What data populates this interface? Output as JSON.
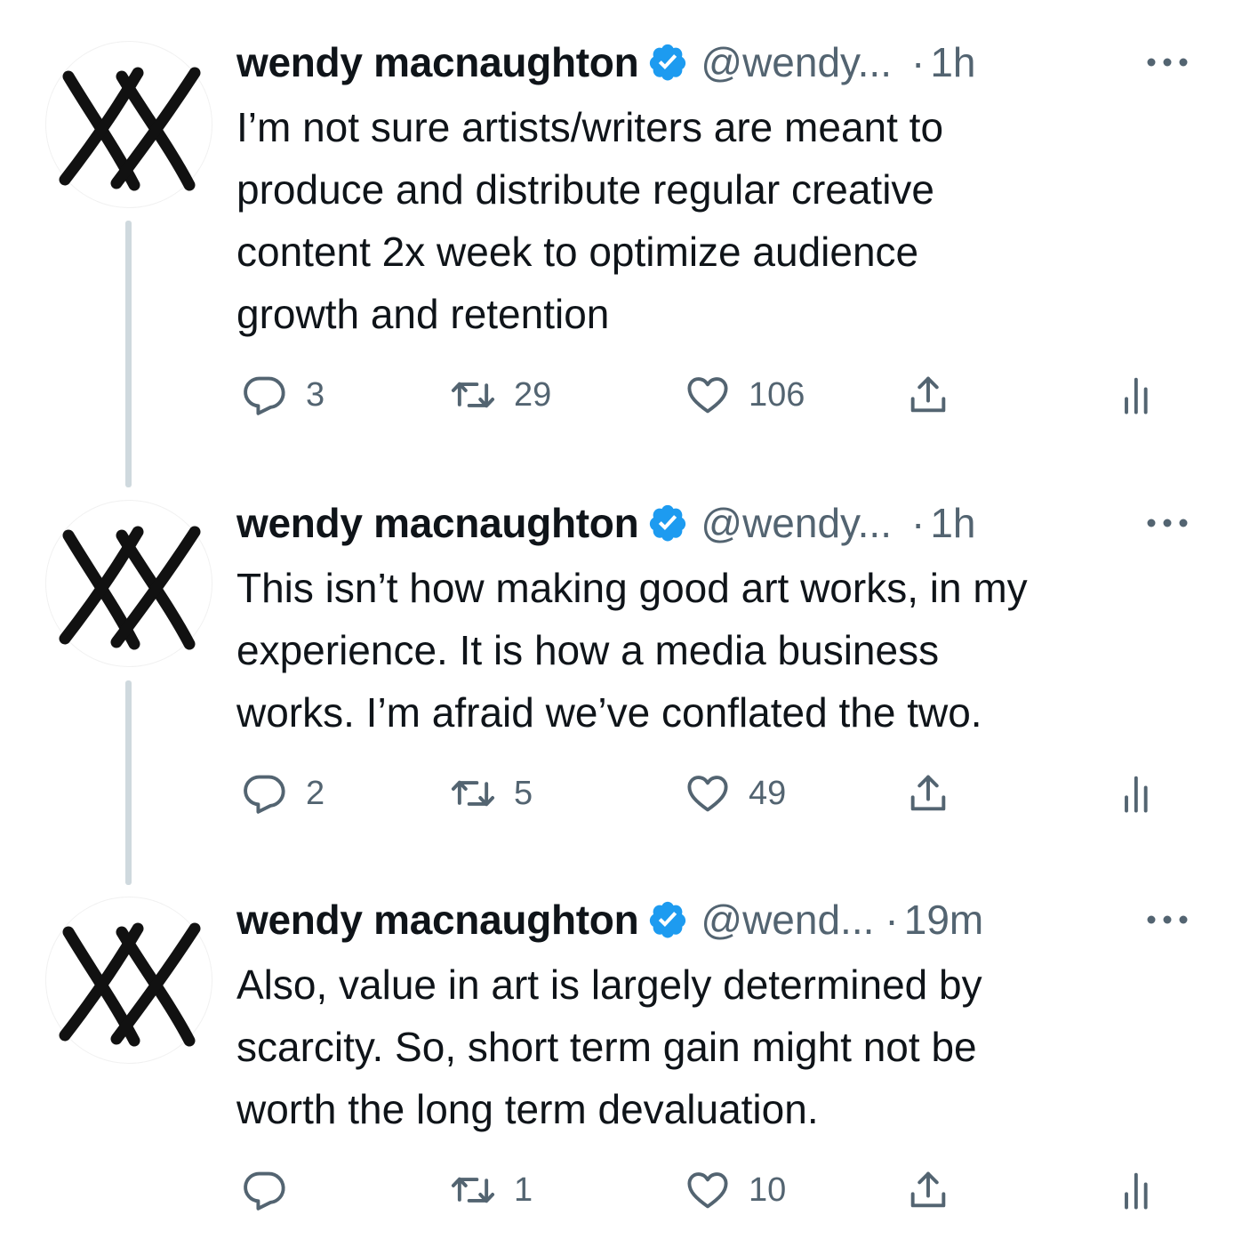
{
  "colors": {
    "text": "#0f1419",
    "muted": "#536471",
    "verified": "#1d9bf0",
    "thread_line": "#cfd9de"
  },
  "tweets": [
    {
      "name": "wendy macnaughton",
      "handle": "@wendy...",
      "separator": "·",
      "time": "1h",
      "text": "I’m not sure artists/writers are meant to\nproduce and distribute regular creative\ncontent 2x week to optimize audience\ngrowth and retention",
      "replies": "3",
      "retweets": "29",
      "likes": "106"
    },
    {
      "name": "wendy macnaughton",
      "handle": "@wendy...",
      "separator": "·",
      "time": "1h",
      "text": "This isn’t how making good art works, in my\nexperience. It is how a media business\nworks. I’m afraid we’ve conflated the two.",
      "replies": "2",
      "retweets": "5",
      "likes": "49"
    },
    {
      "name": "wendy macnaughton",
      "handle": "@wend...",
      "separator": "·",
      "time": "19m",
      "text": "Also, value in art is largely determined by\nscarcity. So, short term gain might not be\nworth the long term devaluation.",
      "replies": "",
      "retweets": "1",
      "likes": "10"
    }
  ],
  "icons": {
    "avatar": "xx-avatar-logo",
    "verified": "verified-badge-icon",
    "more": "more-options-icon",
    "reply": "reply-icon",
    "retweet": "retweet-icon",
    "like": "heart-icon",
    "share": "share-icon",
    "analytics": "analytics-icon"
  }
}
